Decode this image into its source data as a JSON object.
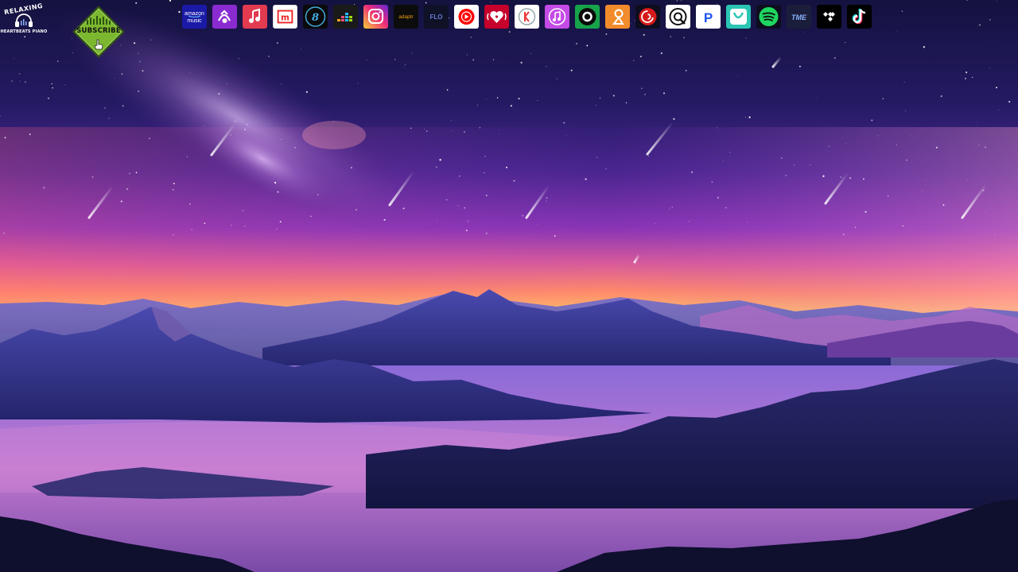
{
  "channel": {
    "name_top": "RELAXING",
    "name_bottom": "HEARTBEATS PIANO",
    "icon": "headphones-icon"
  },
  "subscribe": {
    "label": "SUBSCRIBE",
    "color": "#7cb82f",
    "icon": "hand-pointer-icon"
  },
  "streaming_services": [
    {
      "name": "amazon music",
      "icon": "amazon-music-icon",
      "text": "amazon\nmusic",
      "color": "#1a1aa6"
    },
    {
      "name": "Napster",
      "icon": "napster-icon",
      "text": "",
      "color": "#8a2bd1"
    },
    {
      "name": "Apple Music",
      "icon": "apple-music-icon",
      "text": "",
      "color": "#e23a4f"
    },
    {
      "name": "Melon",
      "icon": "melon-icon",
      "text": "m",
      "color": "#ffffff"
    },
    {
      "name": "Bugs",
      "icon": "bugs-icon",
      "text": "8",
      "color": "#0a0a0a"
    },
    {
      "name": "Deezer",
      "icon": "deezer-icon",
      "text": "",
      "color": "#1a1a1a"
    },
    {
      "name": "Instagram",
      "icon": "instagram-icon",
      "text": "",
      "color": "#c13584"
    },
    {
      "name": "adaptr",
      "icon": "adaptr-icon",
      "text": "adaptr",
      "color": "#0c0c0c"
    },
    {
      "name": "FLO",
      "icon": "flo-icon",
      "text": "FLO",
      "color": "#0f1226"
    },
    {
      "name": "YouTube Music",
      "icon": "youtube-music-icon",
      "text": "",
      "color": "#ffffff"
    },
    {
      "name": "iHeartRadio",
      "icon": "iheartradio-icon",
      "text": "",
      "color": "#c6002b"
    },
    {
      "name": "KKBOX",
      "icon": "kkbox-icon",
      "text": "",
      "color": "#ffffff"
    },
    {
      "name": "iTunes",
      "icon": "itunes-icon",
      "text": "",
      "color": "#c44be6"
    },
    {
      "name": "Anghami",
      "icon": "anghami-icon",
      "text": "",
      "color": "#16a34a"
    },
    {
      "name": "SoundCloud Go",
      "icon": "soundcloud-icon",
      "text": "",
      "color": "#f28b2b"
    },
    {
      "name": "NetEase Cloud Music",
      "icon": "netease-icon",
      "text": "",
      "color": "#d61a1a"
    },
    {
      "name": "QQ Music",
      "icon": "qq-music-icon",
      "text": "",
      "color": "#ffffff"
    },
    {
      "name": "Pandora",
      "icon": "pandora-icon",
      "text": "P",
      "color": "#ffffff"
    },
    {
      "name": "JioSaavn",
      "icon": "jiosaavn-icon",
      "text": "",
      "color": "#2bc5b4"
    },
    {
      "name": "Spotify",
      "icon": "spotify-icon",
      "text": "",
      "color": "#1ed760"
    },
    {
      "name": "TME",
      "icon": "tme-icon",
      "text": "TME",
      "color": "#1b1e3a"
    },
    {
      "name": "TIDAL",
      "icon": "tidal-icon",
      "text": "",
      "color": "#000000"
    },
    {
      "name": "TikTok",
      "icon": "tiktok-icon",
      "text": "",
      "color": "#000000"
    }
  ],
  "background": {
    "icon": "mountain-landscape-icon",
    "sky_top": "#1a1554",
    "sky_horizon": "#ff9a5a",
    "mist": "#b06ac8",
    "mountains": "#1e1f5c"
  }
}
